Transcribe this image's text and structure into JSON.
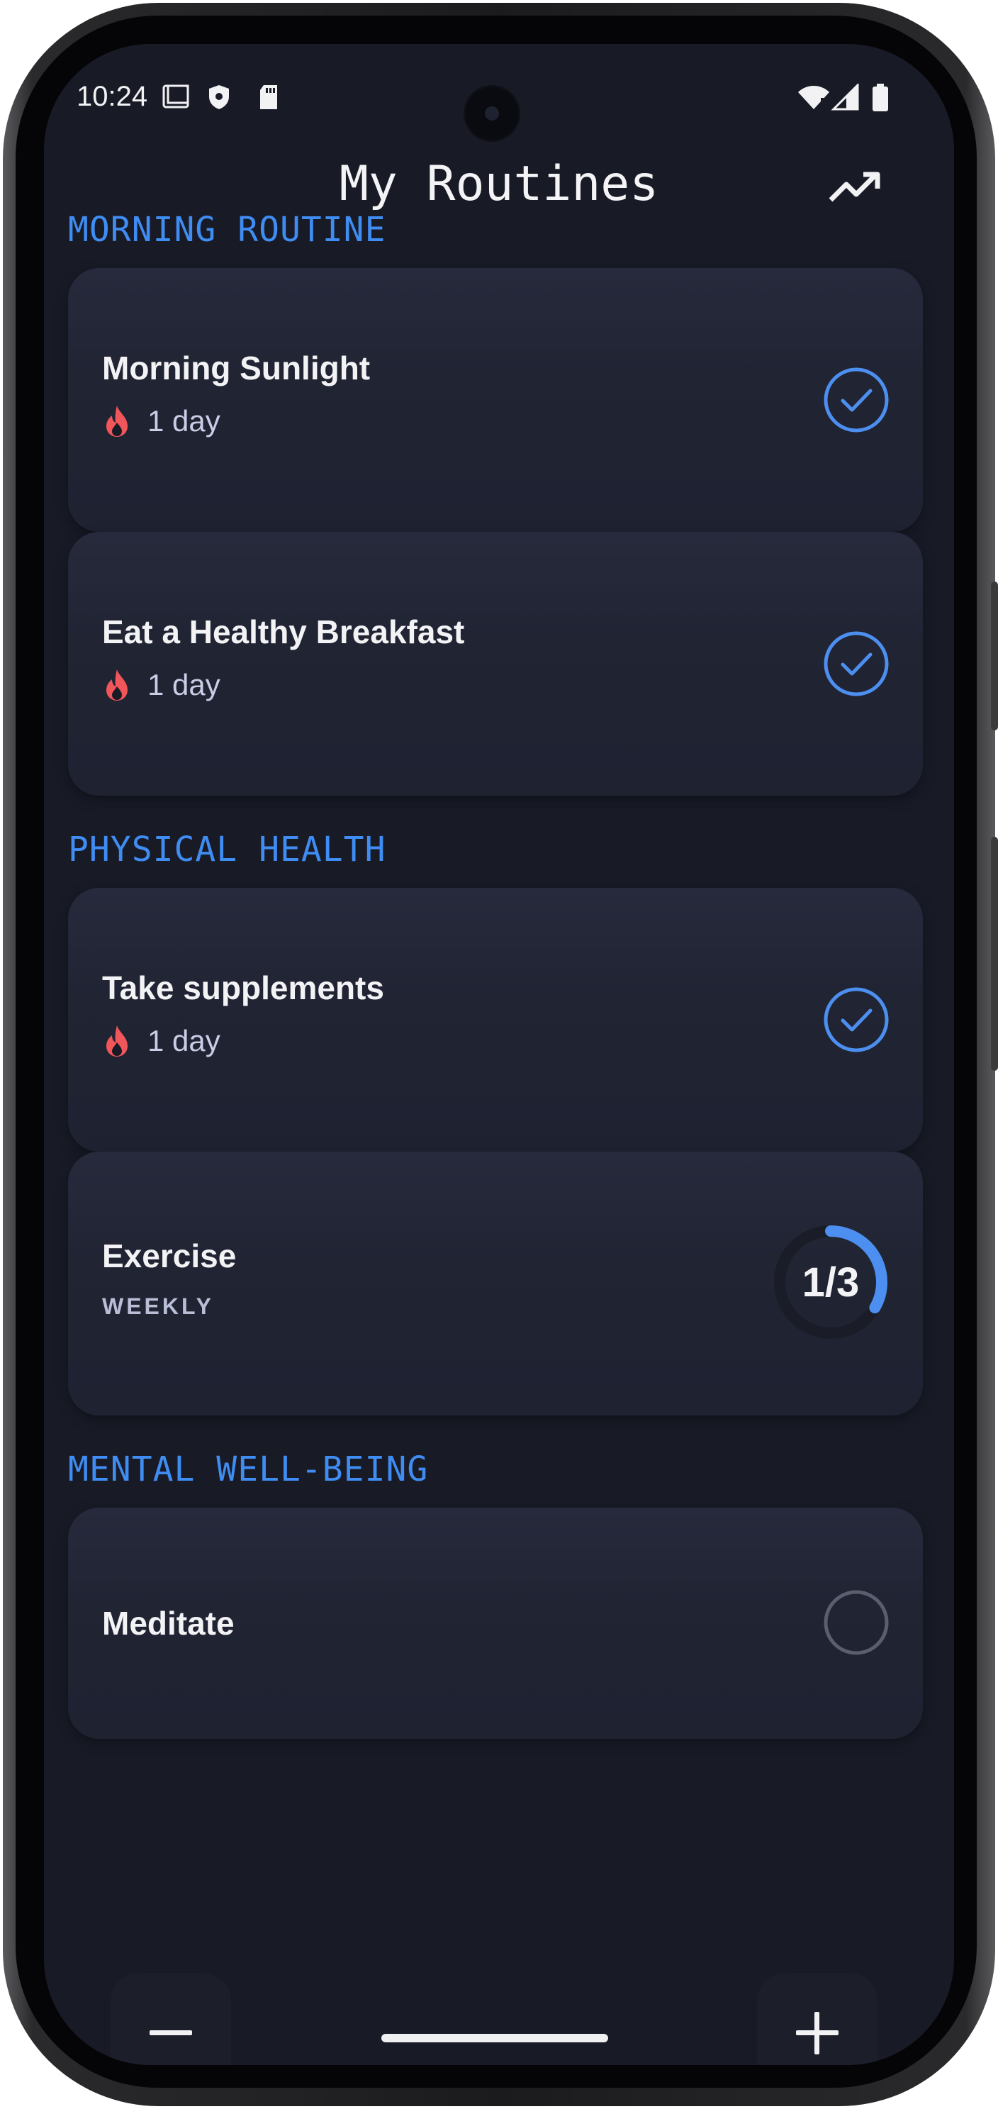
{
  "status_bar": {
    "time": "10:24"
  },
  "header": {
    "title": "My Routines"
  },
  "sections": [
    {
      "title": "MORNING ROUTINE",
      "items": [
        {
          "name": "Morning Sunlight",
          "streak": "1 day",
          "completed": true
        },
        {
          "name": "Eat a Healthy Breakfast",
          "streak": "1 day",
          "completed": true
        }
      ]
    },
    {
      "title": "PHYSICAL HEALTH",
      "items": [
        {
          "name": "Take supplements",
          "streak": "1 day",
          "completed": true
        },
        {
          "name": "Exercise",
          "frequency": "WEEKLY",
          "progress_text": "1/3",
          "progress": 0.3333
        }
      ]
    },
    {
      "title": "MENTAL WELL-BEING",
      "items": [
        {
          "name": "Meditate",
          "completed": false
        }
      ]
    }
  ],
  "colors": {
    "accent": "#3f8cf2",
    "background": "#181b26",
    "card": "#202433",
    "streak_flame": "#f0565a"
  }
}
